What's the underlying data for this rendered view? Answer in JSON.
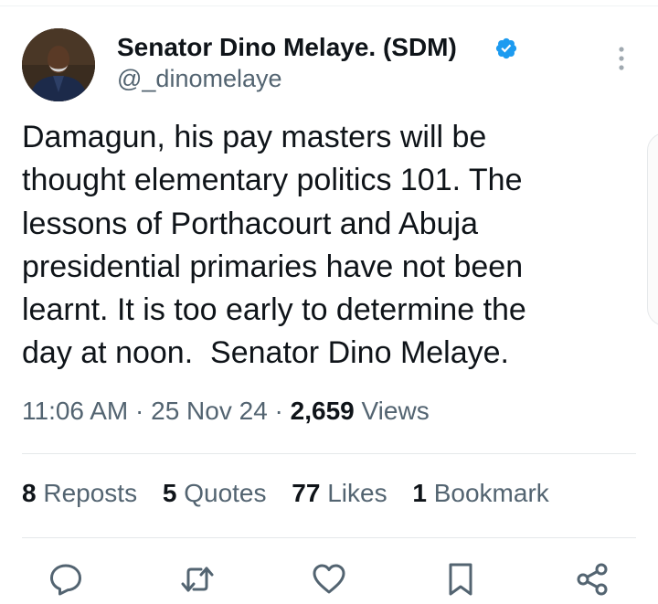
{
  "author": {
    "display_name": "Senator Dino Melaye. (SDM)",
    "handle": "@_dinomelaye",
    "verified": true
  },
  "tweet": {
    "text": "Damagun, his pay masters will be\nthought elementary politics 101. The\nlessons of Porthacourt and Abuja\npresidential primaries have not been\nlearnt. It is too early to determine the\nday at noon.  Senator Dino Melaye."
  },
  "meta": {
    "time": "11:06 AM",
    "separator": "·",
    "date": "25 Nov 24",
    "views_count": "2,659",
    "views_label": "Views"
  },
  "stats": {
    "reposts_count": "8",
    "reposts_label": "Reposts",
    "quotes_count": "5",
    "quotes_label": "Quotes",
    "likes_count": "77",
    "likes_label": "Likes",
    "bookmarks_count": "1",
    "bookmarks_label": "Bookmark"
  },
  "icons": {
    "more": "more-vertical-icon",
    "reply": "reply-icon",
    "repost": "repost-icon",
    "like": "heart-icon",
    "bookmark": "bookmark-icon",
    "share": "share-icon",
    "verified": "verified-badge-icon"
  },
  "colors": {
    "text": "#0f1419",
    "secondary": "#536471",
    "verified": "#1d9bf0",
    "divider": "#e5e8ea"
  }
}
